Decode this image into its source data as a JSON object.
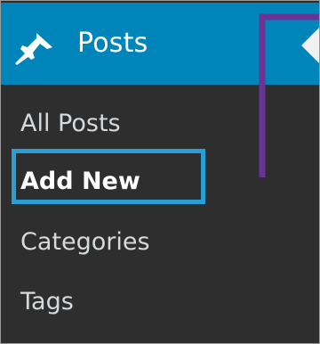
{
  "menu": {
    "header": {
      "label": "Posts",
      "icon": "pin-icon"
    },
    "items": [
      {
        "label": "All Posts",
        "current": false
      },
      {
        "label": "Add New",
        "current": true
      },
      {
        "label": "Categories",
        "current": false
      },
      {
        "label": "Tags",
        "current": false
      }
    ]
  },
  "colors": {
    "header_bg": "#0085bb",
    "menu_bg": "#2e2e2e",
    "highlight": "#2a9ed6",
    "annotation": "#6a3494"
  }
}
